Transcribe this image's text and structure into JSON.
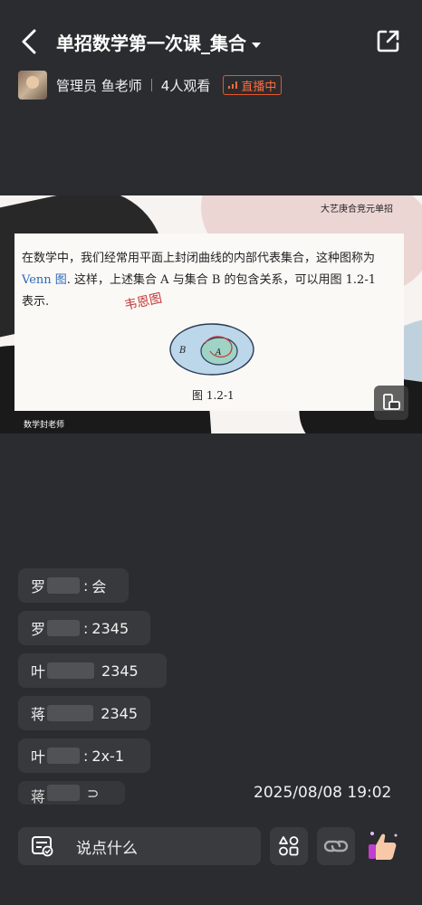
{
  "header": {
    "title": "单招数学第一次课_集合",
    "host_label": "管理员 鱼老师",
    "viewers": "4人观看",
    "live_badge": "直播中"
  },
  "slide": {
    "corner_text": "大艺庚合竞元单招",
    "paragraph_a": "在数学中，我们经常用平面上封闭曲线的内部代表集合，这种图称为",
    "venn_word": "Venn 图",
    "paragraph_b": ". 这样，上述集合 A 与集合 B 的包含关系，可以用图 1.2-1 表示.",
    "stamp": "韦恩图",
    "set_b": "B",
    "set_a": "A",
    "caption": "图 1.2-1",
    "teacher_label": "数学封老师"
  },
  "comments": [
    {
      "name": "罗",
      "text": "会"
    },
    {
      "name": "罗",
      "text": "2345"
    },
    {
      "name": "叶",
      "text": "2345"
    },
    {
      "name": "蒋",
      "text": "2345"
    },
    {
      "name": "叶",
      "text": "2x-1"
    },
    {
      "name": "蒋",
      "text": "⊃"
    }
  ],
  "timestamp": "2025/08/08 19:02",
  "input": {
    "placeholder": "说点什么"
  },
  "icons": {
    "back": "back-arrow-icon",
    "share": "share-icon",
    "rotate": "rotate-screen-icon",
    "note": "note-icon",
    "apps": "apps-icon",
    "link": "link-icon",
    "like": "thumbs-up-icon"
  },
  "colors": {
    "accent": "#ff6a3c",
    "background": "#2b2c2f"
  }
}
